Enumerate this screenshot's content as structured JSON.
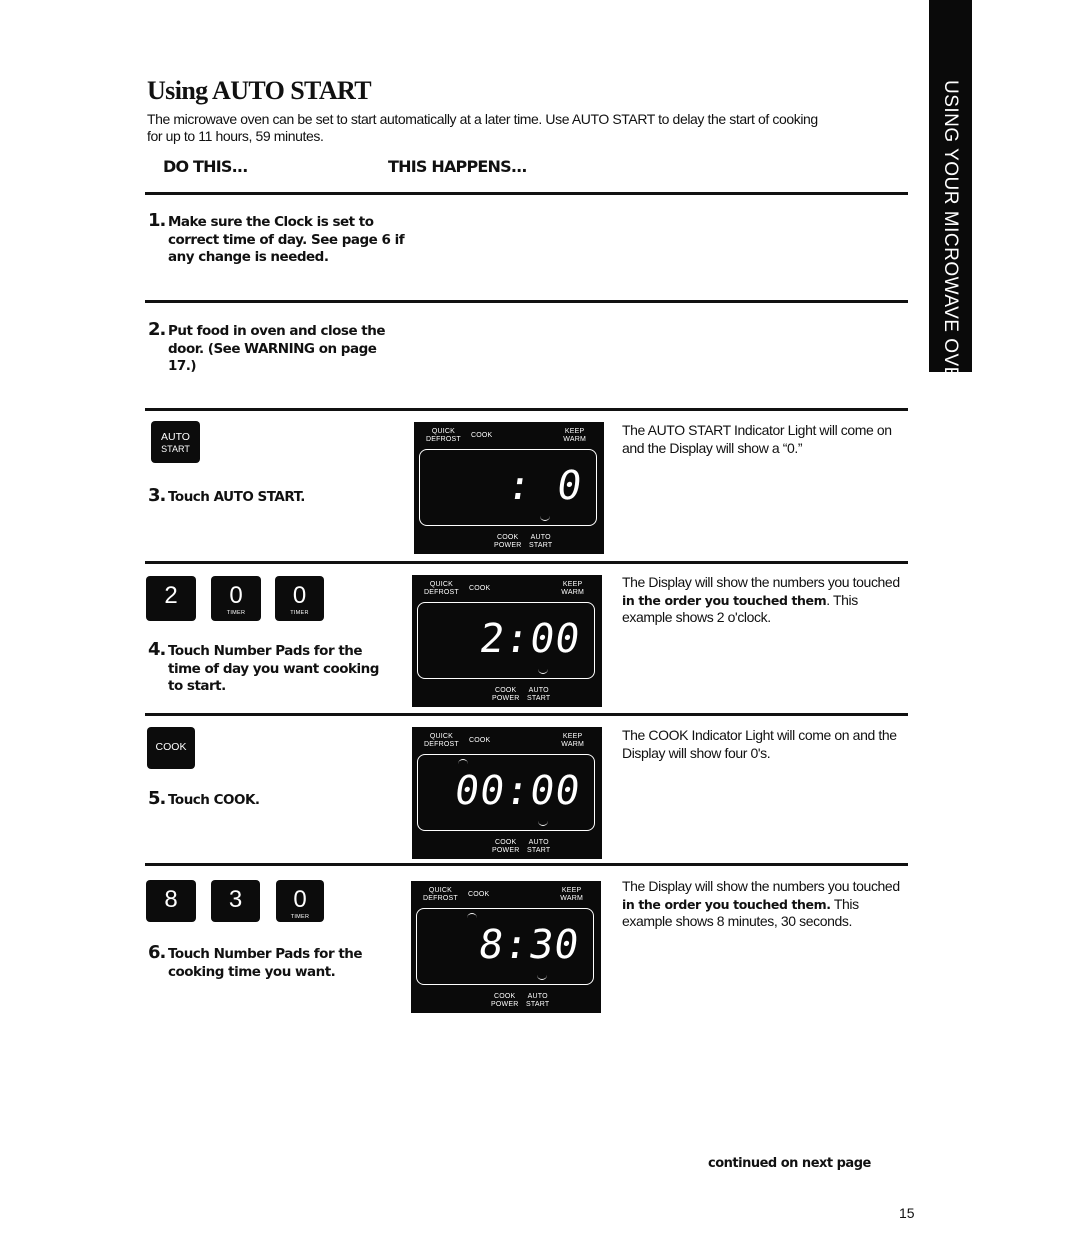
{
  "page": {
    "title": "Using AUTO START",
    "intro": "The microwave oven can be set to start automatically at a later time. Use AUTO START to delay the start of cooking for up to 11 hours, 59 minutes.",
    "column_headers": {
      "do_this": "DO THIS...",
      "this_happens": "THIS HAPPENS..."
    },
    "side_tab": "USING YOUR MICROWAVE OVEN",
    "continued": "continued on next page",
    "page_number": "15"
  },
  "panel_labels": {
    "quick": "QUICK",
    "defrost": "DEFROST",
    "cook": "COOK",
    "keep": "KEEP",
    "warm": "WARM",
    "cook_power_1": "COOK",
    "cook_power_2": "POWER",
    "auto_start_1": "AUTO",
    "auto_start_2": "START"
  },
  "steps": [
    {
      "number": "1.",
      "text": "Make sure the Clock is set to correct time of day. See page 6 if any change is needed."
    },
    {
      "number": "2.",
      "text": "Put food in oven and close the door. (See WARNING on page 17.)"
    },
    {
      "number": "3.",
      "text": "Touch AUTO START.",
      "keys": [
        {
          "line1": "AUTO",
          "line2": "START"
        }
      ],
      "display": " : 0",
      "description": "The AUTO START Indicator Light will come on and the Display will show a “0.”"
    },
    {
      "number": "4.",
      "text": "Touch Number Pads for the time of day you want cooking to start.",
      "keys": [
        {
          "digit": "2",
          "sub": ""
        },
        {
          "digit": "0",
          "sub": "TIMER"
        },
        {
          "digit": "0",
          "sub": "TIMER"
        }
      ],
      "display": "2:00",
      "description": {
        "pre": "The Display will show the numbers you touched ",
        "bold": "in the order you touched them",
        "post": ". This example shows 2 o'clock."
      }
    },
    {
      "number": "5.",
      "text": "Touch COOK.",
      "keys": [
        {
          "label": "COOK"
        }
      ],
      "display": "00:00",
      "description": "The COOK Indicator Light will come on and the Display will show four 0's."
    },
    {
      "number": "6.",
      "text": "Touch Number Pads for the cooking time you want.",
      "keys": [
        {
          "digit": "8",
          "sub": ""
        },
        {
          "digit": "3",
          "sub": ""
        },
        {
          "digit": "0",
          "sub": "TIMER"
        }
      ],
      "display": "8:30",
      "description": {
        "pre": "The Display will show the numbers you touched ",
        "bold": "in the order you touched them.",
        "post": " This example shows 8 minutes, 30 seconds."
      }
    }
  ]
}
